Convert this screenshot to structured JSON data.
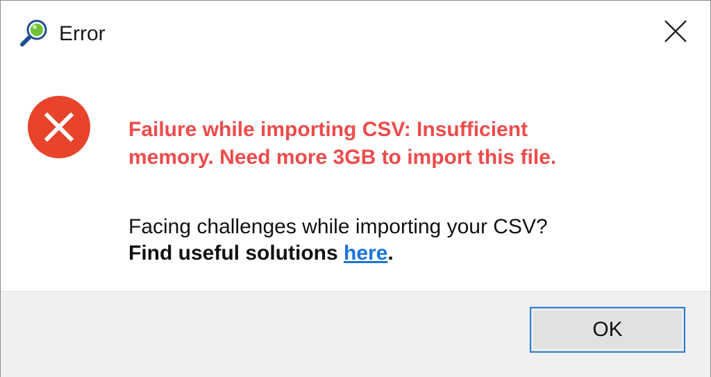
{
  "window": {
    "title": "Error",
    "app_icon": "magnifier-globe-icon",
    "close_icon": "close-icon"
  },
  "message": {
    "icon": "error-x-icon",
    "error_line1": "Failure while importing CSV: Insufficient",
    "error_line2": "memory. Need more 3GB to import this file.",
    "help_question": "Facing challenges while importing your CSV?",
    "help_prefix": "Find useful solutions ",
    "help_link": "here",
    "help_suffix": "."
  },
  "buttons": {
    "ok_label": "OK"
  },
  "colors": {
    "error_text": "#ee4b4b",
    "error_icon": "#e8432b",
    "link": "#1a73d9",
    "focus_border": "#2a7bd4",
    "footer_bg": "#f0f0f0"
  }
}
